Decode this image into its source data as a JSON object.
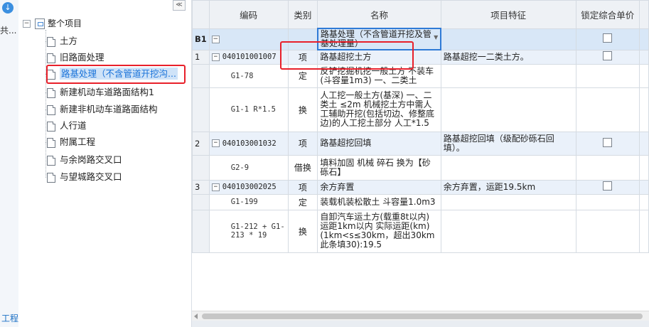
{
  "left_strip": {
    "text_top": "共...",
    "text_bottom": "工程"
  },
  "tree": {
    "collapse": "≪",
    "root": "整个项目",
    "items": [
      {
        "label": "土方"
      },
      {
        "label": "旧路面处理"
      },
      {
        "label": "路基处理（不含管道开挖沟..."
      },
      {
        "label": "新建机动车道路面结构1"
      },
      {
        "label": "新建非机动车道路面结构"
      },
      {
        "label": "人行道"
      },
      {
        "label": "附属工程"
      },
      {
        "label": "与余岗路交叉口"
      },
      {
        "label": "与望城路交叉口"
      }
    ]
  },
  "grid": {
    "headers": {
      "code": "编码",
      "type": "类别",
      "name": "名称",
      "feature": "项目特征",
      "lock": "锁定综合单价"
    },
    "rows": [
      {
        "rn": "B1",
        "toggle": "−",
        "code": "",
        "type": "",
        "name": "路基处理（不含管道开挖及管基处理量）",
        "feature": ""
      },
      {
        "rn": "1",
        "toggle": "−",
        "code": "040101001007",
        "type": "项",
        "name": "路基超挖土方",
        "feature": "路基超挖一二类土方。"
      },
      {
        "rn": "",
        "code": "G1-78",
        "type": "定",
        "name": "反铲挖掘机挖一般土方 不装车(斗容量1m3) 一、二类土",
        "feature": ""
      },
      {
        "rn": "",
        "code": "G1-1 R*1.5",
        "type": "换",
        "name": "人工挖一般土方(基深) 一、二类土 ≤2m 机械挖土方中需人工辅助开挖(包括切边、修整底边)的人工挖土部分 人工*1.5",
        "feature": ""
      },
      {
        "rn": "2",
        "toggle": "−",
        "code": "040103001032",
        "type": "项",
        "name": "路基超挖回填",
        "feature": "路基超挖回填（级配砂砾石回填）。"
      },
      {
        "rn": "",
        "code": "G2-9",
        "type": "借换",
        "name": "填料加固 机械 碎石  换为【砂砾石】",
        "feature": ""
      },
      {
        "rn": "3",
        "toggle": "−",
        "code": "040103002025",
        "type": "项",
        "name": "余方弃置",
        "feature": "余方弃置，运距19.5km"
      },
      {
        "rn": "",
        "code": "G1-199",
        "type": "定",
        "name": "装载机装松散土 斗容量1.0m3",
        "feature": ""
      },
      {
        "rn": "",
        "code": "G1-212 + G1-213 * 19",
        "type": "换",
        "name": "自卸汽车运土方(载重8t以内) 运距1km以内  实际运距(km)(1km<s≤30km，超出30km此条填30):19.5",
        "feature": ""
      }
    ]
  },
  "colors": {
    "highlight_red": "#e8202a",
    "selection_blue": "#cfe3f8",
    "header_name_bg": "#fbe7c9"
  }
}
